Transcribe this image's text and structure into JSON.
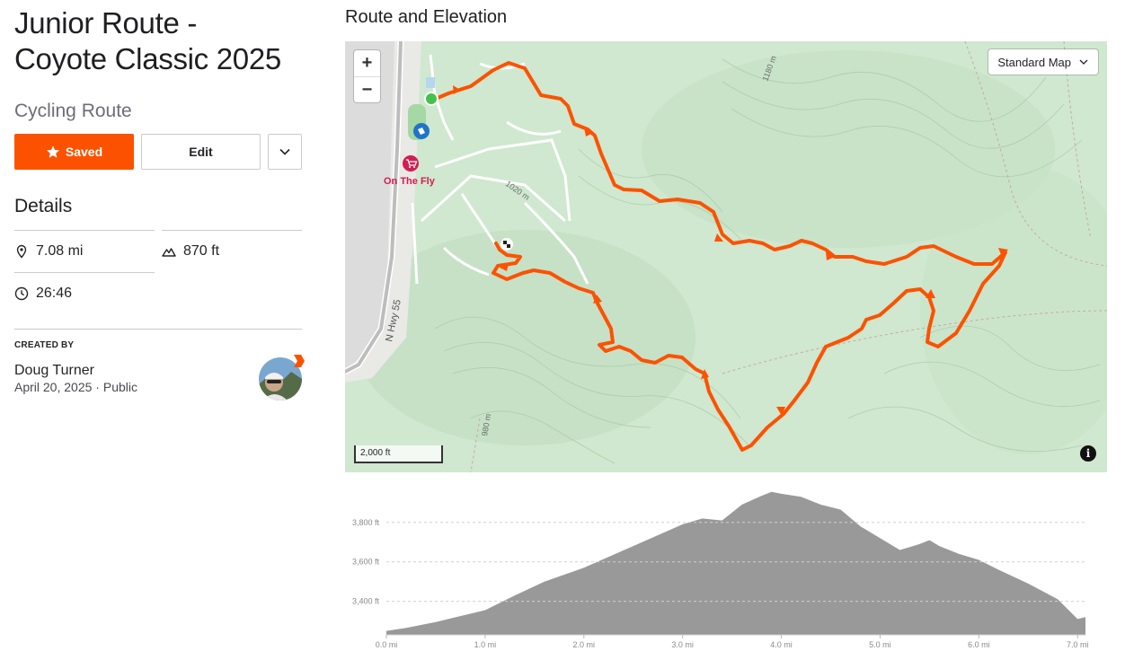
{
  "route": {
    "title_line1": "Junior Route -",
    "title_line2": "Coyote Classic 2025",
    "type": "Cycling Route"
  },
  "actions": {
    "saved_label": "Saved",
    "edit_label": "Edit"
  },
  "details": {
    "heading": "Details",
    "distance": "7.08 mi",
    "elevation_gain": "870 ft",
    "duration": "26:46"
  },
  "creator": {
    "heading": "CREATED BY",
    "name": "Doug Turner",
    "date": "April 20, 2025",
    "visibility": "Public"
  },
  "section_title": "Route and Elevation",
  "map": {
    "style_label": "Standard Map",
    "scale_label": "2,000 ft",
    "poi_label": "On The Fly",
    "road_label": "N Hwy 55",
    "contour_labels": [
      "1020 m",
      "1180 m",
      "980 m"
    ],
    "route_color": "#fc5200",
    "start_color": "#44c24c"
  },
  "chart_data": {
    "type": "area",
    "ylabel": "",
    "y_ticks": [
      "3,400 ft",
      "3,600 ft",
      "3,800 ft"
    ],
    "x_ticks": [
      "0.0 mi",
      "1.0 mi",
      "2.0 mi",
      "3.0 mi",
      "4.0 mi",
      "5.0 mi",
      "6.0 mi",
      "7.0 mi"
    ],
    "xlim": [
      0,
      7.08
    ],
    "ylim": [
      3230,
      3990
    ],
    "x": [
      0,
      0.2,
      0.5,
      1.0,
      1.3,
      1.6,
      2.0,
      2.5,
      3.0,
      3.2,
      3.4,
      3.6,
      3.8,
      3.9,
      4.0,
      4.2,
      4.4,
      4.6,
      4.8,
      5.0,
      5.2,
      5.4,
      5.5,
      5.6,
      5.8,
      6.0,
      6.2,
      6.5,
      6.8,
      7.0,
      7.08
    ],
    "y": [
      3250,
      3265,
      3295,
      3355,
      3430,
      3500,
      3570,
      3680,
      3790,
      3820,
      3810,
      3890,
      3935,
      3955,
      3945,
      3930,
      3890,
      3865,
      3780,
      3720,
      3660,
      3690,
      3710,
      3680,
      3640,
      3610,
      3560,
      3490,
      3410,
      3310,
      3320
    ],
    "fill_color": "#999999"
  }
}
